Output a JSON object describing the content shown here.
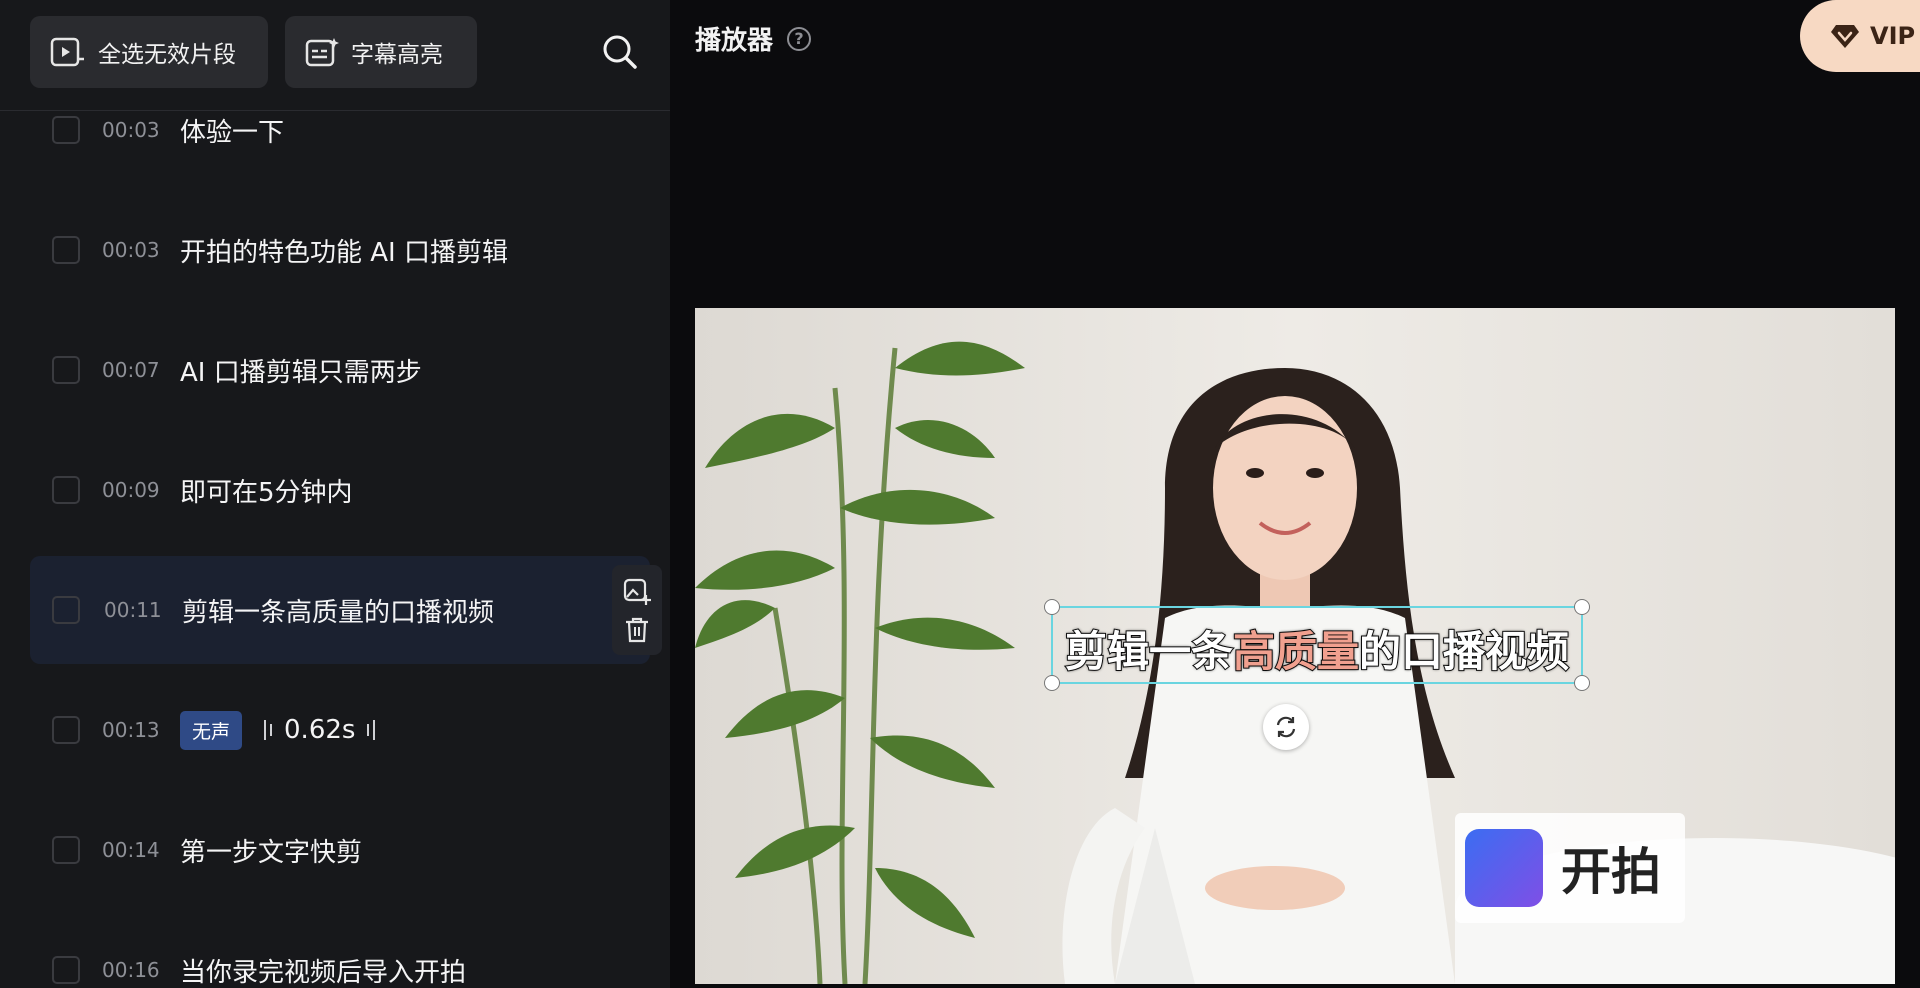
{
  "toolbar": {
    "select_invalid_label": "全选无效片段",
    "subtitle_highlight_label": "字幕高亮"
  },
  "segments": [
    {
      "time": "00:03",
      "text": "体验一下"
    },
    {
      "time": "00:03",
      "text": "开拍的特色功能 AI 口播剪辑"
    },
    {
      "time": "00:07",
      "text": "AI 口播剪辑只需两步"
    },
    {
      "time": "00:09",
      "text": "即可在5分钟内"
    },
    {
      "time": "00:11",
      "text": "剪辑一条高质量的口播视频",
      "active": true
    },
    {
      "time": "00:13",
      "badge": "无声",
      "duration": "0.62s"
    },
    {
      "time": "00:14",
      "text": "第一步文字快剪"
    },
    {
      "time": "00:16",
      "text": "当你录完视频后导入开拍"
    }
  ],
  "player": {
    "title": "播放器",
    "help_glyph": "?",
    "vip_label": "VIP",
    "subtitle_before": "剪辑一条",
    "subtitle_highlight": "高质量",
    "subtitle_after": "的口播视频",
    "watermark_text": "开拍"
  },
  "colors": {
    "accent_active_row": "#1b2130",
    "silent_badge": "#2f4a86",
    "vip_bg": "#f7d9c3",
    "subtitle_highlight": "#f0a08f",
    "selection_box": "#6ad5e0"
  }
}
